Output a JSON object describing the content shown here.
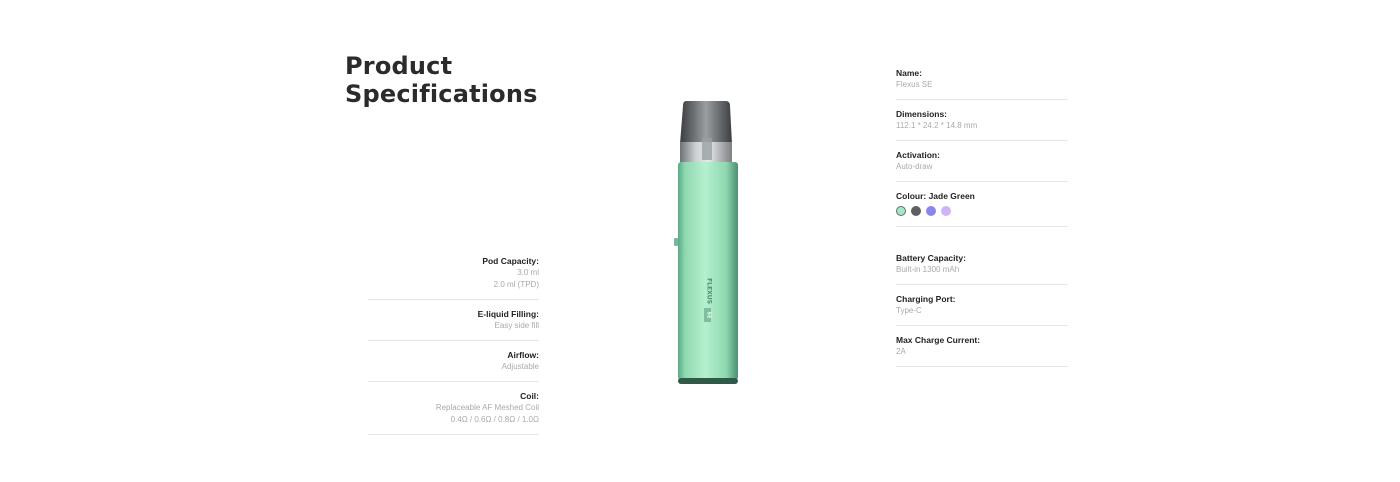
{
  "page_title": {
    "line1": "Product",
    "line2": "Specifications"
  },
  "left_specs": [
    {
      "label": "Pod Capacity:",
      "values": [
        "3.0 ml",
        "2.0 ml (TPD)"
      ]
    },
    {
      "label": "E-liquid Filling:",
      "values": [
        "Easy side fill"
      ]
    },
    {
      "label": "Airflow:",
      "values": [
        "Adjustable"
      ]
    },
    {
      "label": "Coil:",
      "values": [
        "Replaceable AF Meshed Coil",
        "0.4Ω / 0.6Ω / 0.8Ω / 1.0Ω"
      ]
    }
  ],
  "right_specs_top": [
    {
      "label": "Name:",
      "value": "Flexus SE"
    },
    {
      "label": "Dimensions:",
      "value": "112.1 * 24.2 * 14.8 mm"
    },
    {
      "label": "Activation:",
      "value": "Auto-draw"
    }
  ],
  "colour": {
    "label": "Colour: Jade Green",
    "swatches": [
      {
        "name": "Jade Green",
        "color": "#9fe8c8",
        "selected": true
      },
      {
        "name": "Dark Grey",
        "color": "#5f5f5f",
        "selected": false
      },
      {
        "name": "Blue",
        "color": "#8a86ee",
        "selected": false
      },
      {
        "name": "Lavender",
        "color": "#cfb2f7",
        "selected": false
      }
    ]
  },
  "right_specs_bottom": [
    {
      "label": "Battery Capacity:",
      "value": "Built-in 1300 mAh"
    },
    {
      "label": "Charging Port:",
      "value": "Type-C"
    },
    {
      "label": "Max Charge Current:",
      "value": "2A"
    }
  ],
  "device": {
    "brand_text": "FLEXUS",
    "model_text": "SE",
    "body_color": "#8fd9b0"
  }
}
